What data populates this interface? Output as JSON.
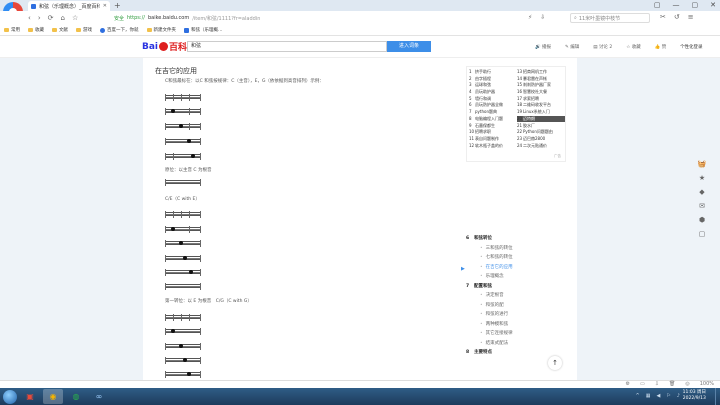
{
  "browser": {
    "tab_title": "和弦（乐理概念）_百度百科",
    "new_tab": "+",
    "window_controls": [
      "▢",
      "—",
      "▢",
      "✕"
    ],
    "nav": [
      "‹",
      "›",
      "⟳",
      "⌂",
      "☆"
    ],
    "addr_secure": "安全",
    "addr_scheme": "https://",
    "addr_url": "baike.baidu.com",
    "addr_rest": "/item/和弦/1111?fr=aladdin",
    "toolbar_icons": [
      "⚡",
      "⇩"
    ],
    "search_placeholder": "11米叶墨镜中枝节",
    "right_icons": [
      "✂",
      "↺",
      "≡"
    ]
  },
  "bookmarks": [
    {
      "label": "常用"
    },
    {
      "label": "收藏"
    },
    {
      "label": "文献"
    },
    {
      "label": "游戏"
    },
    {
      "label": "百度一下，你就"
    },
    {
      "label": "新建文件夹"
    },
    {
      "label": "和弦（乐理概…"
    }
  ],
  "baike": {
    "logo_text": "Bai",
    "logo_bk": "百科",
    "search_value": "和弦",
    "search_button": "进入词条",
    "tools": [
      "播报",
      "编辑",
      "讨论 2",
      "收藏",
      "赞"
    ],
    "login": "个性化登录"
  },
  "content": {
    "section_title": "在吉它的应用",
    "intro": "C和弦最标在：以C 和弦按规律：C（主音），E，G（依依据到高音排列）示例：",
    "caption_root": "原位：以主音 C 为根音",
    "caption_ce": "C/E（C with E）",
    "caption_first": "第一转位：以 E 为根音　C/G（C with G）"
  },
  "related": [
    {
      "num": "1",
      "text": "挤手助行"
    },
    {
      "num": "13",
      "text": "招商网机工作"
    },
    {
      "num": "2",
      "text": "由字插程"
    },
    {
      "num": "14",
      "text": "暴君雷在声帐"
    },
    {
      "num": "3",
      "text": "运球和弦"
    },
    {
      "num": "15",
      "text": "刹刹防护器厂家"
    },
    {
      "num": "4",
      "text": "员玩助护器"
    },
    {
      "num": "16",
      "text": "智慧校社大餐"
    },
    {
      "num": "5",
      "text": "墙行和调"
    },
    {
      "num": "17",
      "text": "求索招聘"
    },
    {
      "num": "6",
      "text": "员玩防护器全做"
    },
    {
      "num": "18",
      "text": "二维码收发平台"
    },
    {
      "num": "7",
      "text": "python题典"
    },
    {
      "num": "19",
      "text": "Linux系统入门"
    },
    {
      "num": "8",
      "text": "电脑编程入门题"
    },
    {
      "num": "20",
      "text": "迈特朗",
      "hl": true
    },
    {
      "num": "9",
      "text": "石墨保都生"
    },
    {
      "num": "21",
      "text": "胶水厂"
    },
    {
      "num": "10",
      "text": "招聘求职"
    },
    {
      "num": "22",
      "text": "Python问题题由"
    },
    {
      "num": "11",
      "text": "表自问题制作"
    },
    {
      "num": "23",
      "text": "迈巴赫2800"
    },
    {
      "num": "12",
      "text": "软木瓶子盖的价"
    },
    {
      "num": "24",
      "text": "二次元贴通价"
    }
  ],
  "related_footer": "广告",
  "toc": [
    {
      "level": 1,
      "num": "6",
      "text": "和弦转位"
    },
    {
      "level": 2,
      "text": "三和弦的转位"
    },
    {
      "level": 2,
      "text": "七和弦的转位"
    },
    {
      "level": 2,
      "text": "在吉它的应用",
      "active": true
    },
    {
      "level": 2,
      "text": "乐理概念"
    },
    {
      "level": 1,
      "num": "7",
      "text": "配置和弦"
    },
    {
      "level": 2,
      "text": "决定根音"
    },
    {
      "level": 2,
      "text": "和弦的配"
    },
    {
      "level": 2,
      "text": "和弦的进行"
    },
    {
      "level": 2,
      "text": "两种模和弦"
    },
    {
      "level": 2,
      "text": "其它连接规律"
    },
    {
      "level": 2,
      "text": "结束式配法"
    },
    {
      "level": 1,
      "num": "8",
      "text": "主要特点"
    }
  ],
  "edge_tools": [
    "🧺",
    "★",
    "◆",
    "✉",
    "⬢",
    "▢"
  ],
  "backtop": "↑",
  "status_icons": [
    "⚙",
    "▭",
    "⇩",
    "🗑",
    "◎",
    "100%"
  ],
  "tray": [
    "^",
    "▦",
    "◀",
    "⚐",
    "♪"
  ],
  "clock_time": "11:03 周日",
  "clock_date": "2022/9/13"
}
